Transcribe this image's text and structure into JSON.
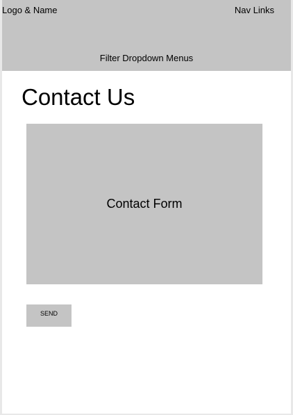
{
  "header": {
    "logo_label": "Logo & Name",
    "nav_label": "Nav Links",
    "filter_label": "Filter Dropdown Menus"
  },
  "main": {
    "title": "Contact Us",
    "form_placeholder": "Contact Form",
    "send_label": "SEND"
  },
  "colors": {
    "placeholder_fill": "#c4c4c4",
    "page_background": "#ffffff",
    "outer_background": "#e8e8e8"
  }
}
